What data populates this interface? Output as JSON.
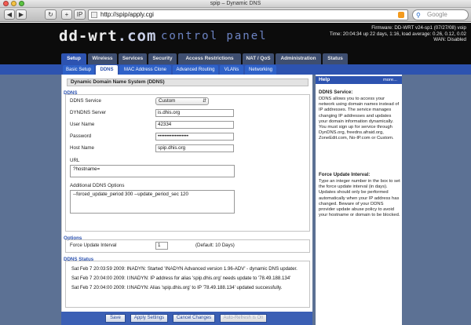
{
  "window": {
    "title": "spip – Dynamic DNS"
  },
  "browser": {
    "url": "http://spip/apply.cgi",
    "search_placeholder": "Google",
    "back_label": "◀",
    "forward_label": "▶",
    "reload_label": "↻",
    "add_label": "+",
    "ip_label": "IP"
  },
  "header": {
    "logo_main": "dd-wrt",
    "logo_com": ".com",
    "control_panel": "control panel",
    "firmware": "Firmware: DD-WRT v24-sp1 (07/27/08) voip",
    "time": "Time: 20:04:34 up 22 days, 1:16, load average: 0.26, 0.12, 0.02",
    "wan": "WAN: Disabled"
  },
  "tabs": [
    "Setup",
    "Wireless",
    "Services",
    "Security",
    "Access Restrictions",
    "NAT / QoS",
    "Administration",
    "Status"
  ],
  "subtabs": [
    "Basic Setup",
    "DDNS",
    "MAC Address Clone",
    "Advanced Routing",
    "VLANs",
    "Networking"
  ],
  "section_title": "Dynamic Domain Name System (DDNS)",
  "ddns": {
    "legend": "DDNS",
    "service_label": "DDNS Service",
    "service_value": "Custom",
    "server_label": "DYNDNS Server",
    "server_value": "is.dhis.org",
    "username_label": "User Name",
    "username_value": "42334",
    "password_label": "Password",
    "password_value": "••••••••••••••••••",
    "hostname_label": "Host Name",
    "hostname_value": "spip.dhis.org",
    "url_label": "URL",
    "url_value": "?hostname=",
    "additional_label": "Additional DDNS Options",
    "additional_value": "--forced_update_period 300 --update_period_sec 120"
  },
  "options": {
    "legend": "Options",
    "force_label": "Force Update Interval",
    "force_value": "1",
    "force_default": "(Default: 10 Days)"
  },
  "status": {
    "legend": "DDNS Status",
    "lines": [
      "Sat Feb 7 20:03:59 2009: INADYN: Started 'INADYN Advanced version 1.96-ADV' - dynamic DNS updater.",
      "Sat Feb 7 20:04:00 2009: I:INADYN: IP address for alias 'spip.dhis.org' needs update to '78.49.188.134'",
      "Sat Feb 7 20:04:00 2009: I:INADYN: Alias 'spip.dhis.org' to IP '78.49.188.134' updated successfully."
    ]
  },
  "buttons": {
    "save": "Save",
    "apply": "Apply Settings",
    "cancel": "Cancel Changes",
    "autorefresh": "Auto-Refresh is On"
  },
  "help": {
    "title": "Help",
    "more": "more...",
    "ddns_title": "DDNS Service:",
    "ddns_text": "DDNS allows you to access your network using domain names instead of IP addresses. The service manages changing IP addresses and updates your domain information dynamically. You must sign up for service through DynDNS.org, freedns.afraid.org, ZoneEdit.com, No-IP.com or Custom.",
    "force_title": "Force Update Interval:",
    "force_text": "Type an integer number in the box to set the force update interval (in days). Updates should only be performed automatically when your IP address has changed. Beware of your DDNS provider update abuse policy to avoid your hostname or domain to be blocked."
  }
}
